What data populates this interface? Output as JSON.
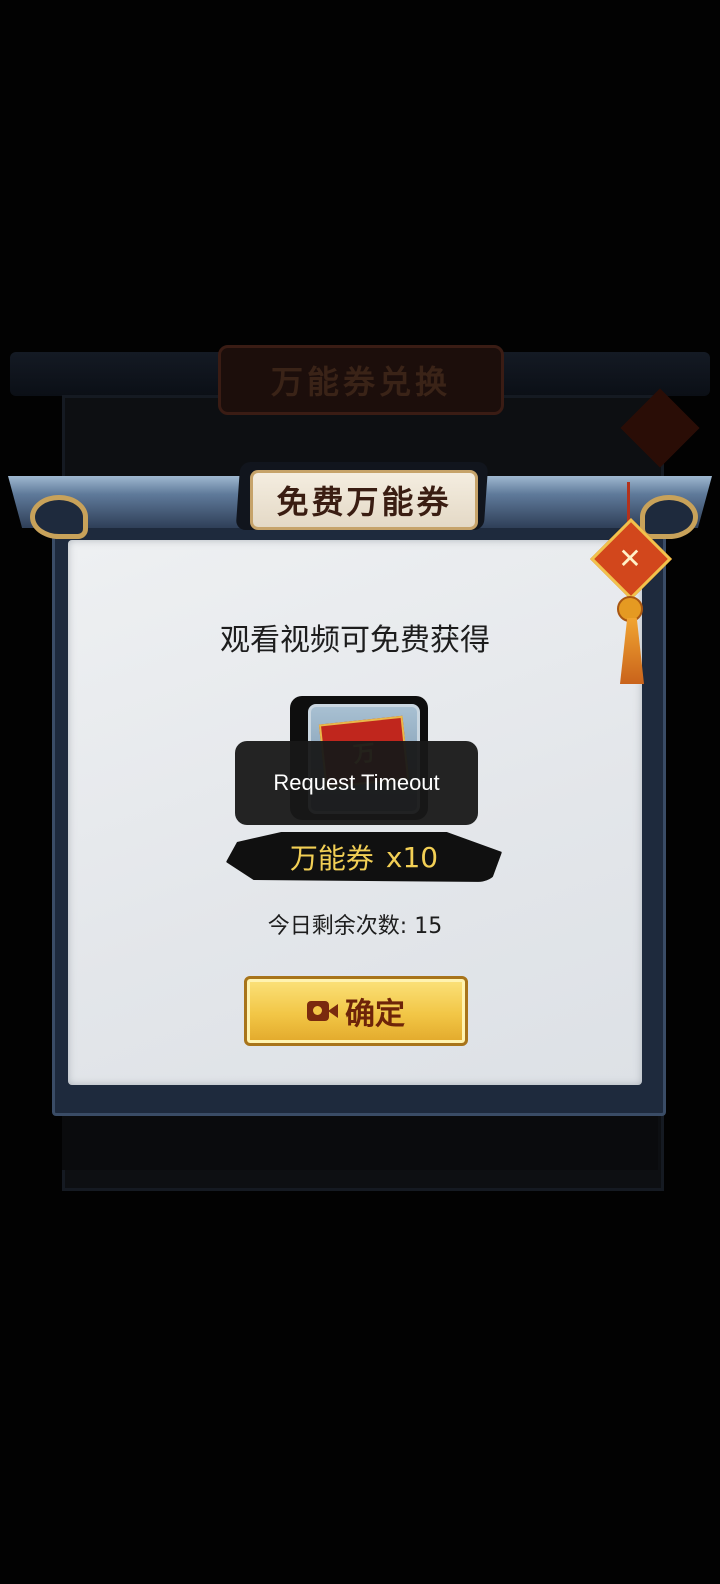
{
  "background": {
    "behind_title": "万能券兑换"
  },
  "dialog": {
    "title": "免费万能券",
    "subtitle": "观看视频可免费获得",
    "reward": {
      "item_glyph": "万",
      "name": "万能券",
      "quantity": "x10"
    },
    "remaining": "今日剩余次数: 15",
    "confirm_label": "确定",
    "confirm_icon": "video-camera-icon",
    "charm_icon": "crossed-tools-icon"
  },
  "toast": {
    "message": "Request Timeout"
  }
}
